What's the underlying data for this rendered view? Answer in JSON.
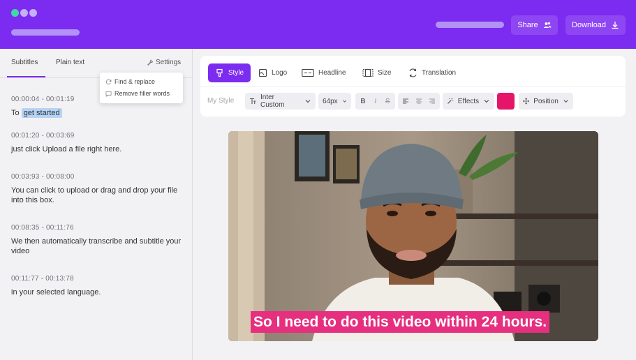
{
  "header": {
    "share_label": "Share",
    "download_label": "Download"
  },
  "left_panel": {
    "tabs": [
      {
        "label": "Subtitles",
        "active": true
      },
      {
        "label": "Plain text",
        "active": false
      }
    ],
    "settings_label": "Settings",
    "settings_menu": [
      "Find & replace",
      "Remove filler words"
    ],
    "subtitles": [
      {
        "time": "00:00:04 - 00:01:19",
        "text_before": "To ",
        "text_highlight": "get started"
      },
      {
        "time": "00:01:20 - 00:03:69",
        "text": "just click Upload a file right here."
      },
      {
        "time": "00:03:93 - 00:08:00",
        "text": "You can click to upload or drag and drop your file into this box."
      },
      {
        "time": "00:08:35 - 00:11:76",
        "text": "We then automatically transcribe and subtitle your video"
      },
      {
        "time": "00:11:77 - 00:13:78",
        "text": "in your selected language."
      }
    ]
  },
  "toolbar": {
    "tabs": [
      {
        "label": "Style",
        "icon": "brush-icon",
        "active": true
      },
      {
        "label": "Logo",
        "icon": "image-icon",
        "active": false
      },
      {
        "label": "Headline",
        "icon": "headline-icon",
        "active": false
      },
      {
        "label": "Size",
        "icon": "size-icon",
        "active": false
      },
      {
        "label": "Translation",
        "icon": "translate-icon",
        "active": false
      }
    ],
    "style_placeholder": "My Style",
    "font_name": "Inter Custom",
    "font_size": "64px",
    "format_glyphs": [
      "B",
      "I",
      "S"
    ],
    "effects_label": "Effects",
    "color": "#e5166a",
    "position_label": "Position"
  },
  "video": {
    "caption": "So I need to do this video within 24 hours."
  },
  "colors": {
    "brand": "#7c2bf0",
    "caption_bg": "#e62f7e",
    "highlight": "#b6d3f5"
  }
}
